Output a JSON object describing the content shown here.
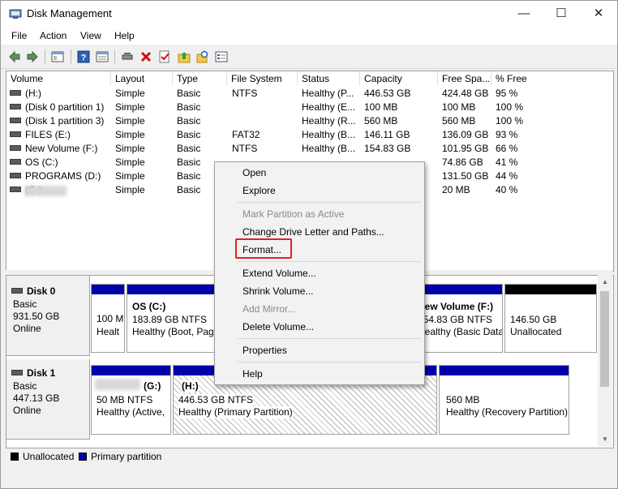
{
  "window": {
    "title": "Disk Management",
    "min_glyph": "—",
    "max_glyph": "☐",
    "close_glyph": "✕"
  },
  "menu": [
    "File",
    "Action",
    "View",
    "Help"
  ],
  "columns": [
    "Volume",
    "Layout",
    "Type",
    "File System",
    "Status",
    "Capacity",
    "Free Spa...",
    "% Free"
  ],
  "volumes": [
    {
      "volume": "(H:)",
      "layout": "Simple",
      "type": "Basic",
      "fs": "NTFS",
      "status": "Healthy (P...",
      "capacity": "446.53 GB",
      "free": "424.48 GB",
      "pct": "95 %"
    },
    {
      "volume": "(Disk 0 partition 1)",
      "layout": "Simple",
      "type": "Basic",
      "fs": "",
      "status": "Healthy (E...",
      "capacity": "100 MB",
      "free": "100 MB",
      "pct": "100 %"
    },
    {
      "volume": "(Disk 1 partition 3)",
      "layout": "Simple",
      "type": "Basic",
      "fs": "",
      "status": "Healthy (R...",
      "capacity": "560 MB",
      "free": "560 MB",
      "pct": "100 %"
    },
    {
      "volume": "FILES (E:)",
      "layout": "Simple",
      "type": "Basic",
      "fs": "FAT32",
      "status": "Healthy (B...",
      "capacity": "146.11 GB",
      "free": "136.09 GB",
      "pct": "93 %"
    },
    {
      "volume": "New Volume (F:)",
      "layout": "Simple",
      "type": "Basic",
      "fs": "NTFS",
      "status": "Healthy (B...",
      "capacity": "154.83 GB",
      "free": "101.95 GB",
      "pct": "66 %"
    },
    {
      "volume": "OS (C:)",
      "layout": "Simple",
      "type": "Basic",
      "fs": "",
      "status": "",
      "capacity": "",
      "free": "74.86 GB",
      "pct": "41 %"
    },
    {
      "volume": "PROGRAMS (D:)",
      "layout": "Simple",
      "type": "Basic",
      "fs": "",
      "status": "",
      "capacity": "",
      "free": "131.50 GB",
      "pct": "44 %"
    },
    {
      "volume": "(G:)",
      "layout": "Simple",
      "type": "Basic",
      "fs": "",
      "status": "",
      "capacity": "",
      "free": "20 MB",
      "pct": "40 %"
    }
  ],
  "disks": [
    {
      "name": "Disk 0",
      "kind": "Basic",
      "size": "931.50 GB",
      "state": "Online",
      "partitions": [
        {
          "title": "",
          "l1": "100 M",
          "l2": "Healt"
        },
        {
          "title": "OS  (C:)",
          "l1": "183.89 GB NTFS",
          "l2": "Healthy (Boot, Pag"
        },
        {
          "title": "New Volume  (F:)",
          "l1": "154.83 GB NTFS",
          "l2": "Healthy (Basic Data"
        },
        {
          "title": "",
          "l1": "146.50 GB",
          "l2": "Unallocated"
        }
      ]
    },
    {
      "name": "Disk 1",
      "kind": "Basic",
      "size": "447.13 GB",
      "state": "Online",
      "partitions": [
        {
          "title": "(G:)",
          "l1": "50 MB NTFS",
          "l2": "Healthy (Active,"
        },
        {
          "title": "(H:)",
          "l1": "446.53 GB NTFS",
          "l2": "Healthy (Primary Partition)"
        },
        {
          "title": "",
          "l1": "560 MB",
          "l2": "Healthy (Recovery Partition)"
        }
      ]
    }
  ],
  "legend": [
    "Unallocated",
    "Primary partition"
  ],
  "context_menu": {
    "open": "Open",
    "explore": "Explore",
    "mark_active": "Mark Partition as Active",
    "change_letter": "Change Drive Letter and Paths...",
    "format": "Format...",
    "extend": "Extend Volume...",
    "shrink": "Shrink Volume...",
    "add_mirror": "Add Mirror...",
    "delete": "Delete Volume...",
    "properties": "Properties",
    "help": "Help"
  },
  "colors": {
    "primary": "#0000a8",
    "unallocated": "#000000",
    "highlight": "#e02020",
    "disabled": "#8a8a8a"
  }
}
